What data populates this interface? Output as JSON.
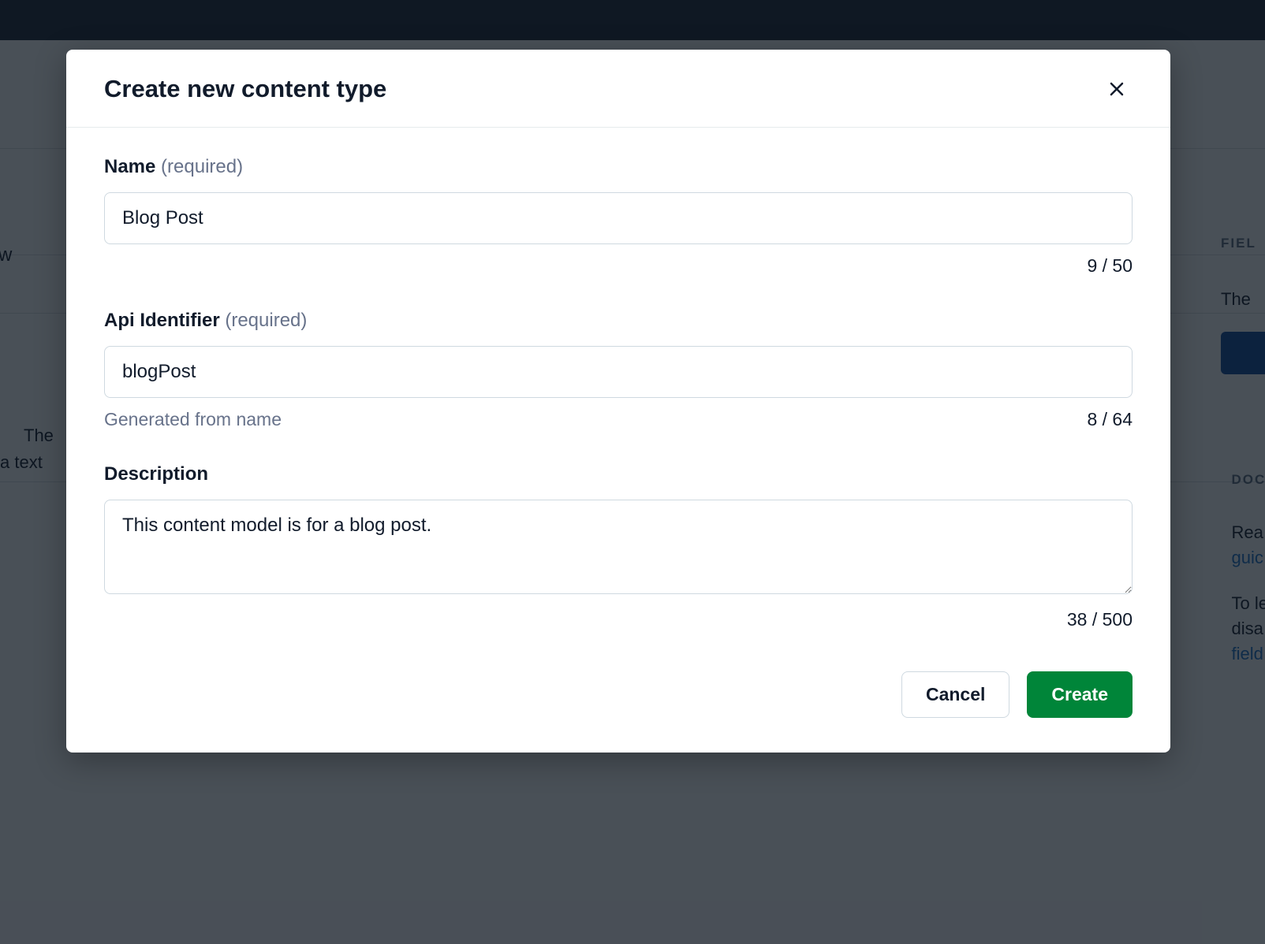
{
  "modal": {
    "title": "Create new content type",
    "fields": {
      "name": {
        "label": "Name",
        "required_tag": "(required)",
        "value": "Blog Post",
        "counter": "9 / 50"
      },
      "api_identifier": {
        "label": "Api Identifier",
        "required_tag": "(required)",
        "value": "blogPost",
        "helper": "Generated from name",
        "counter": "8 / 64"
      },
      "description": {
        "label": "Description",
        "value": "This content model is for a blog post.",
        "counter": "38 / 500"
      }
    },
    "buttons": {
      "cancel": "Cancel",
      "create": "Create"
    }
  },
  "background": {
    "left_tab": "w",
    "left_body_line1": "The",
    "left_body_line2": "a text",
    "right_section1_label": "FIEL",
    "right_section1_text": "The",
    "right_section2_label": "DOC",
    "right_section2_line1": "Rea",
    "right_section2_link1": "guic",
    "right_section2_line2": "To le",
    "right_section2_line3": "disa",
    "right_section2_link2": "field"
  }
}
